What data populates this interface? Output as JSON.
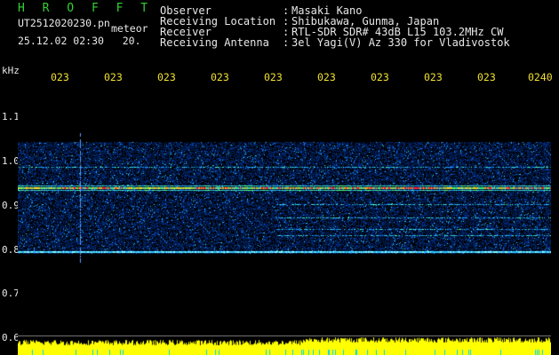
{
  "header": {
    "app_title": "H R O F F T",
    "file_name": "UT2512020230.pn",
    "file_tag": "meteor",
    "datetime": "25.12.02 02:30",
    "datetime_extra": "20.",
    "info": [
      {
        "label": "Observer",
        "value": "Masaki Kano"
      },
      {
        "label": "Receiving Location",
        "value": "Shibukawa, Gunma, Japan"
      },
      {
        "label": "Receiver",
        "value": "RTL-SDR SDR# 43dB L15 103.2MHz CW"
      },
      {
        "label": "Receiving Antenna",
        "value": "3el Yagi(V) Az 330 for Vladivostok"
      }
    ],
    "separator": ":"
  },
  "axes": {
    "unit_label": "kHz",
    "y_ticks": [
      "1.1",
      "1.0",
      "0.9",
      "0.8",
      "0.7",
      "0.6"
    ],
    "x_ticks": [
      "023",
      "023",
      "023",
      "023",
      "023",
      "023",
      "023",
      "023",
      "023",
      "0240"
    ]
  },
  "colors": {
    "background": "#000000",
    "text": "#e8e8e8",
    "title": "#32d232",
    "time_labels": "#f0e030",
    "amplitude": "#ffff00"
  },
  "spectrogram": {
    "freq_range_khz": [
      0.79,
      1.04
    ],
    "strong_echo_line_khz": 0.935,
    "baseline_line_khz": 0.795,
    "weak_lines_khz": [
      0.985,
      0.9,
      0.87,
      0.845,
      0.83
    ]
  }
}
